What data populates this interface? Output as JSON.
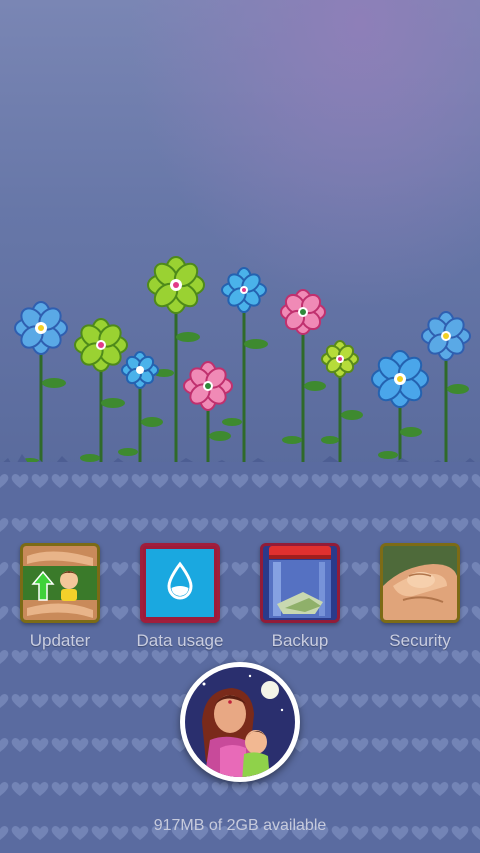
{
  "apps": [
    {
      "label": "Updater",
      "icon": "hands-child-arrow-icon"
    },
    {
      "label": "Data usage",
      "icon": "water-drop-icon"
    },
    {
      "label": "Backup",
      "icon": "jar-icon"
    },
    {
      "label": "Security",
      "icon": "holding-hands-icon"
    }
  ],
  "dock": {
    "icon": "mother-child-icon"
  },
  "storage": {
    "text": "917MB of 2GB available"
  },
  "colors": {
    "sky": "#6a78aa",
    "ground": "#5a6ba0",
    "data_tile": "#1aa8e0",
    "label": "#c9cde0"
  }
}
